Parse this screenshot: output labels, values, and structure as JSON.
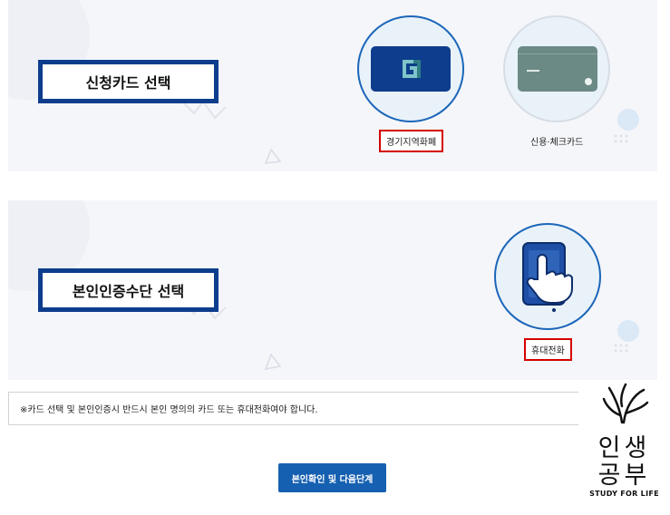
{
  "card_section": {
    "label": "신청카드 선택",
    "options": [
      {
        "label": "경기지역화폐",
        "icon": "gyeonggi-local-currency-card-icon",
        "selected": true
      },
      {
        "label": "신용·체크카드",
        "icon": "credit-card-icon",
        "selected": false
      }
    ]
  },
  "auth_section": {
    "label": "본인인증수단 선택",
    "options": [
      {
        "label": "휴대전화",
        "icon": "mobile-phone-icon",
        "selected": true
      }
    ]
  },
  "notice": "※카드 선택 및 본인인증시 반드시 본인 명의의 카드 또는 휴대전화여야 합니다.",
  "next_button": "본인확인 및 다음단계",
  "watermark": {
    "line1": "인생",
    "line2": "공부",
    "line3": "STUDY FOR LIFE"
  },
  "colors": {
    "primary": "#1660b1",
    "label_border": "#0d3d8c",
    "highlight": "#d40000",
    "panel_bg": "#f5f6fa"
  }
}
